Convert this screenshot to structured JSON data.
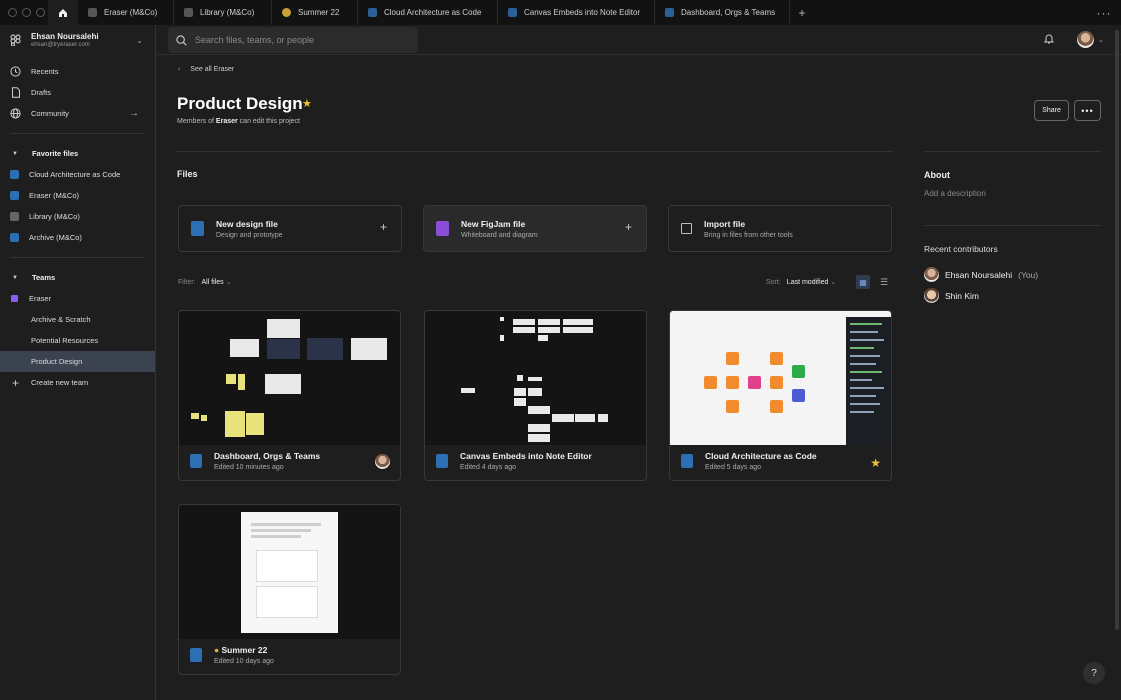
{
  "tabs": [
    {
      "label": "Eraser (M&Co)",
      "icon": "file-icon"
    },
    {
      "label": "Library (M&Co)",
      "icon": "file-icon"
    },
    {
      "label": "Summer 22",
      "icon": "sun-icon"
    },
    {
      "label": "Cloud Architecture as Code",
      "icon": "file-icon"
    },
    {
      "label": "Canvas Embeds into Note Editor",
      "icon": "file-icon"
    },
    {
      "label": "Dashboard, Orgs & Teams",
      "icon": "file-icon"
    }
  ],
  "account": {
    "name": "Ehsan Noursalehi",
    "email": "ehsan@tryeraser.com"
  },
  "nav": {
    "recents": "Recents",
    "drafts": "Drafts",
    "community": "Community"
  },
  "favorites": {
    "title": "Favorite files",
    "items": [
      "Cloud Architecture as Code",
      "Eraser (M&Co)",
      "Library (M&Co)",
      "Archive (M&Co)"
    ]
  },
  "teams": {
    "title": "Teams",
    "items": [
      "Eraser",
      "Archive & Scratch",
      "Potential Resources",
      "Product Design"
    ],
    "create": "Create new team"
  },
  "search": {
    "placeholder": "Search files, teams, or people"
  },
  "project": {
    "back": "See all Eraser",
    "title": "Product Design",
    "subtitle_prefix": "Members of",
    "subtitle_org": "Eraser",
    "subtitle_suffix": "can edit this project",
    "share": "Share",
    "more": "•••"
  },
  "files_heading": "Files",
  "new_cards": [
    {
      "title": "New design file",
      "subtitle": "Design and prototype"
    },
    {
      "title": "New FigJam file",
      "subtitle": "Whiteboard and diagram"
    },
    {
      "title": "Import file",
      "subtitle": "Bring in files from other tools"
    }
  ],
  "filter": {
    "label": "Filter:",
    "value": "All files"
  },
  "sort": {
    "label": "Sort:",
    "value": "Last modified"
  },
  "files": [
    {
      "name": "Dashboard, Orgs & Teams",
      "edited": "Edited 10 minutes ago"
    },
    {
      "name": "Canvas Embeds into Note Editor",
      "edited": "Edited 4 days ago"
    },
    {
      "name": "Cloud Architecture as Code",
      "edited": "Edited 5 days ago"
    },
    {
      "name": "Summer 22",
      "edited": "Edited 10 days ago"
    }
  ],
  "about": {
    "title": "About",
    "description": "Add a description"
  },
  "contributors": {
    "title": "Recent contributors",
    "items": [
      {
        "name": "Ehsan Noursalehi",
        "suffix": "(You)"
      },
      {
        "name": "Shin Kim",
        "suffix": ""
      }
    ]
  },
  "help": "?",
  "colors": {
    "accent": "#2c6fb5",
    "star": "#f2c12e",
    "team": "#8a5cf6",
    "figjam": "#8a4fd6"
  }
}
